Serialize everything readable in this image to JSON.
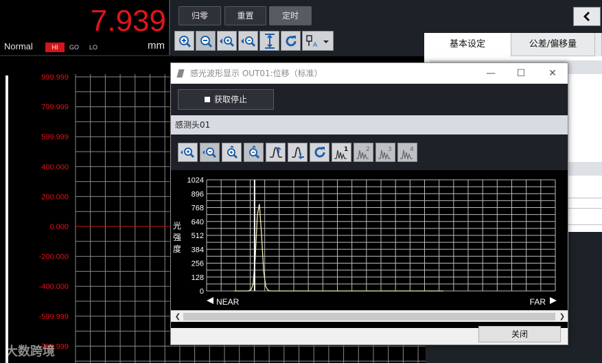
{
  "readout": {
    "value": "7.939",
    "mode": "Normal",
    "unit": "mm",
    "judge": [
      "HI",
      "GO",
      "LO"
    ]
  },
  "toolbar": {
    "zero_label": "归零",
    "reset_label": "重置",
    "timer_label": "定时"
  },
  "toolbar_icons": [
    "zoom-in-icon",
    "zoom-out-icon",
    "zoom-x-icon",
    "zoom-x-out-icon",
    "fit-vertical-icon",
    "refresh-icon",
    "probe-select-icon"
  ],
  "right_panel": {
    "tabs": [
      "基本设定",
      "公差/偏移量"
    ]
  },
  "main_chart": {
    "y_ticks": [
      "999.999",
      "799.999",
      "599.999",
      "400.000",
      "200.000",
      "0.000",
      "-200.000",
      "-400.000",
      "-599.999",
      "-799.999"
    ]
  },
  "dialog": {
    "title": "感光波形显示 OUT01:位移（标准）",
    "stop_label": "获取停止",
    "sensor_head": "感测头01",
    "close_label": "关闭",
    "tool_icons": [
      "zoom-x-in-icon",
      "zoom-x-out-icon",
      "zoom-y-in-icon",
      "zoom-y-out-icon",
      "peak-rise-icon",
      "peak-fall-icon",
      "refresh-icon",
      "peak1-icon",
      "peak2-icon",
      "peak3-icon",
      "peak4-icon"
    ],
    "peak_numbers": [
      "1",
      "2",
      "3",
      "4"
    ]
  },
  "chart_data": {
    "type": "line",
    "ylabel": "光强度",
    "y_ticks": [
      "1024",
      "896",
      "768",
      "640",
      "512",
      "384",
      "256",
      "128",
      "0"
    ],
    "ylim": [
      0,
      1024
    ],
    "x_near_label": "NEAR",
    "x_far_label": "FAR",
    "series": [
      {
        "values": [
          0,
          0,
          0,
          0,
          0,
          0,
          0,
          2,
          10,
          60,
          300,
          700,
          800,
          520,
          180,
          40,
          8,
          0,
          0,
          0,
          0,
          0,
          0,
          0,
          0,
          0,
          0,
          0,
          0,
          0,
          0,
          0,
          0,
          0,
          0,
          0,
          0,
          0,
          0,
          0,
          0,
          0,
          0,
          0,
          0,
          0,
          0,
          0,
          0,
          0,
          0,
          0,
          0,
          0,
          0,
          0,
          0,
          0,
          0,
          0,
          0,
          0,
          0,
          0,
          0,
          0,
          0,
          0,
          0,
          0,
          0,
          0,
          0,
          0,
          0,
          0,
          0,
          0,
          0,
          0,
          0,
          0,
          0,
          0,
          0,
          0,
          0,
          0,
          0,
          0,
          0,
          0,
          0,
          0,
          0,
          0,
          0,
          0,
          0,
          0
        ]
      }
    ],
    "cursor_index": 11,
    "grid": true
  },
  "watermark": "大数跨境"
}
